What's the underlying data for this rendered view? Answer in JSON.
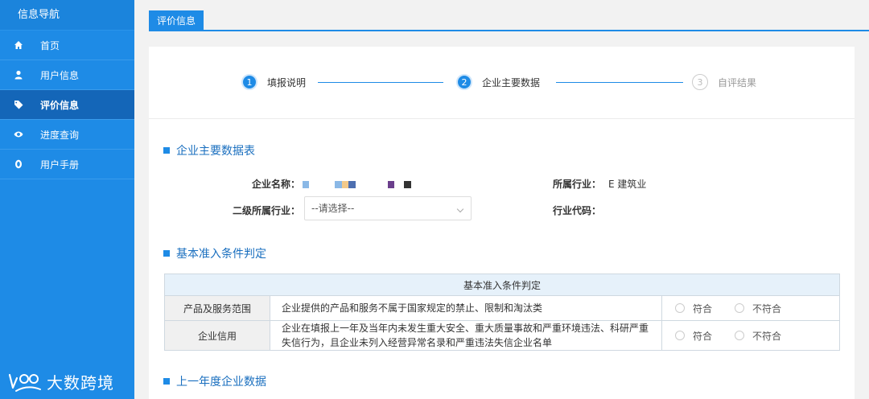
{
  "sidebar": {
    "title": "信息导航",
    "items": [
      {
        "label": "首页",
        "icon": "home-icon"
      },
      {
        "label": "用户信息",
        "icon": "user-icon"
      },
      {
        "label": "评价信息",
        "icon": "tag-icon",
        "active": true
      },
      {
        "label": "进度查询",
        "icon": "eye-icon"
      },
      {
        "label": "用户手册",
        "icon": "book-icon"
      }
    ]
  },
  "watermark": "大数跨境",
  "tab": {
    "label": "评价信息"
  },
  "steps": [
    {
      "num": "1",
      "label": "填报说明",
      "state": "done"
    },
    {
      "num": "2",
      "label": "企业主要数据",
      "state": "done"
    },
    {
      "num": "3",
      "label": "自评结果",
      "state": "todo"
    }
  ],
  "section1": {
    "title": "企业主要数据表",
    "company_name_label": "企业名称：",
    "industry_label": "所属行业：",
    "industry_value": "E 建筑业",
    "sub_industry_label": "二级所属行业：",
    "sub_industry_placeholder": "--请选择--",
    "industry_code_label": "行业代码：",
    "redacted_colors": [
      "#8ab8e6",
      "#8ab8e6",
      "#f2c98a",
      "#4d6fb0",
      "#6b3f8c",
      "#333333"
    ]
  },
  "section2": {
    "title": "基本准入条件判定",
    "table_header": "基本准入条件判定",
    "rows": [
      {
        "name": "产品及服务范围",
        "desc": "企业提供的产品和服务不属于国家规定的禁止、限制和淘汰类",
        "opt_yes": "符合",
        "opt_no": "不符合"
      },
      {
        "name": "企业信用",
        "desc": "企业在填报上一年及当年内未发生重大安全、重大质量事故和严重环境违法、科研严重失信行为，且企业未列入经营异常名录和严重违法失信企业名单",
        "opt_yes": "符合",
        "opt_no": "不符合"
      }
    ]
  },
  "section3": {
    "title": "上一年度企业数据"
  },
  "colors": {
    "sidebar": "#1e8be6",
    "active": "#1466b8",
    "accent": "#1e8be6"
  }
}
